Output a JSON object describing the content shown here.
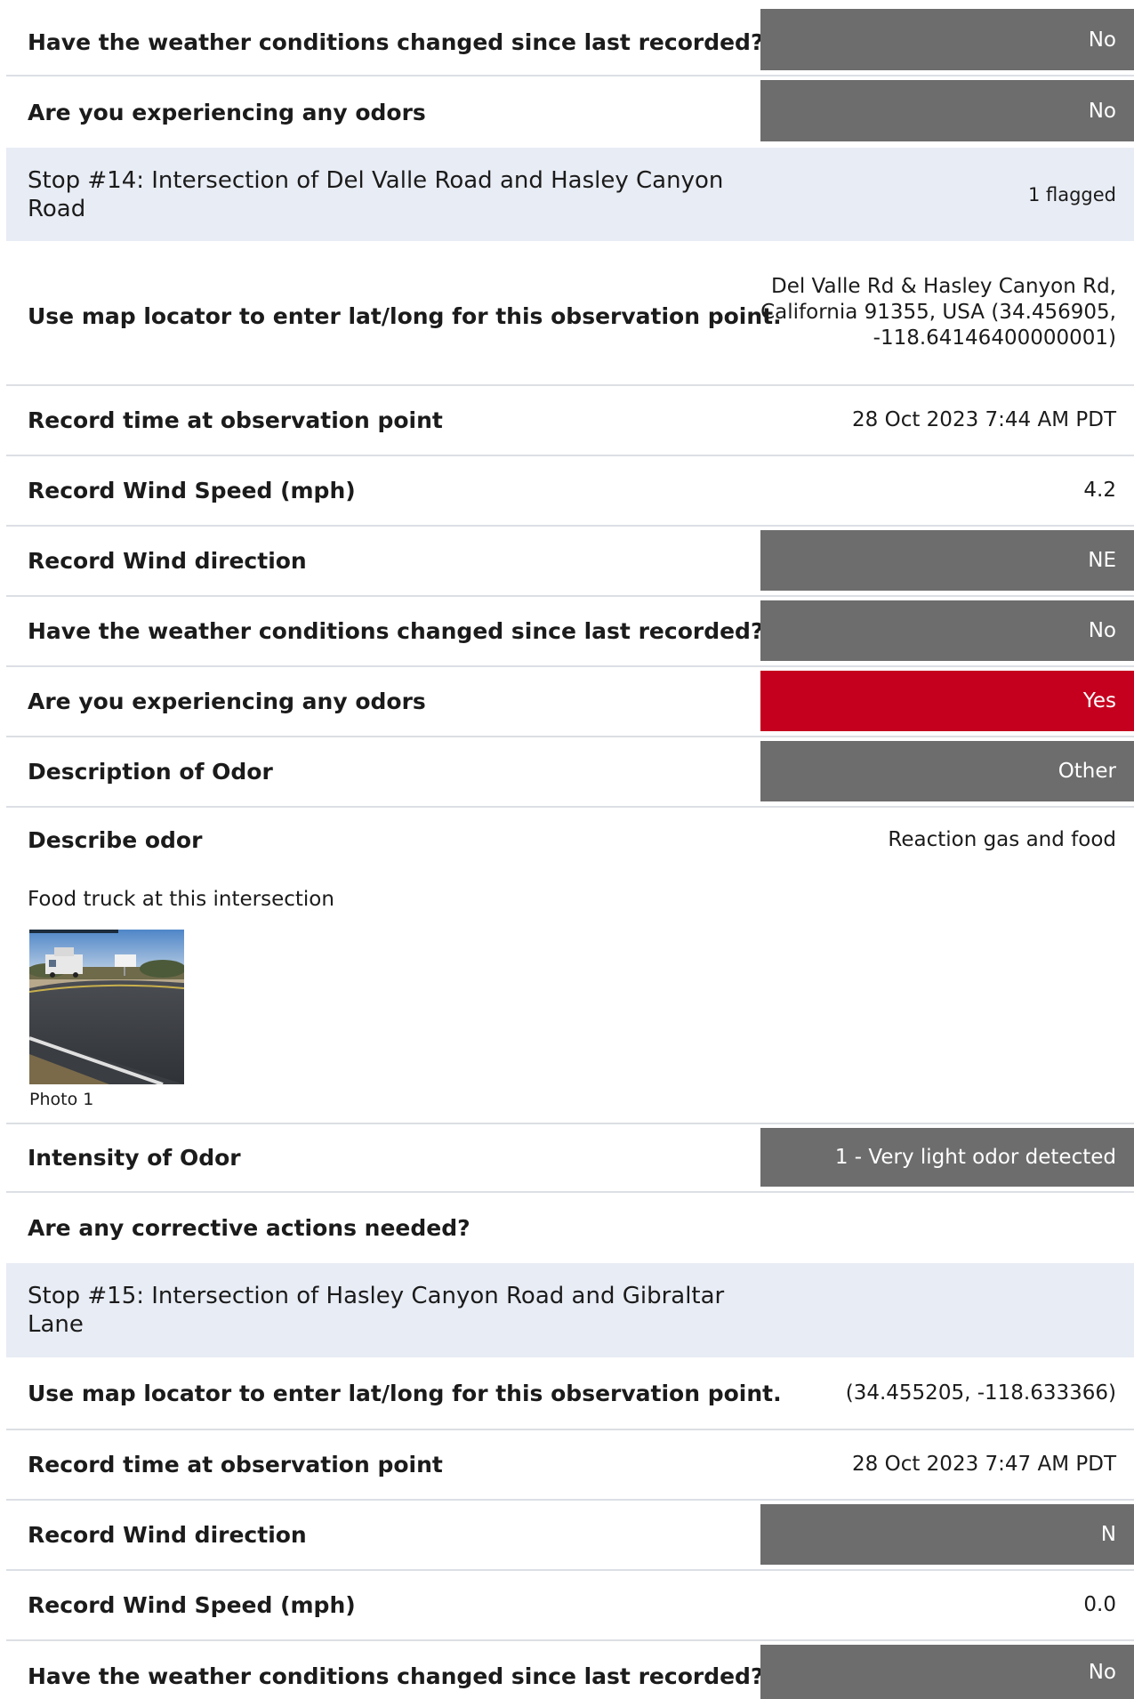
{
  "rows_a": [
    {
      "q": "Have the weather conditions changed since last recorded?",
      "v": "No",
      "style": "grey"
    },
    {
      "q": "Are you experiencing any odors",
      "v": "No",
      "style": "grey"
    }
  ],
  "stop14": {
    "title": "Stop #14: Intersection of Del Valle Road and Hasley Canyon Road",
    "flag": "1 flagged"
  },
  "stop14_rows": [
    {
      "q": "Use map locator to enter lat/long for this observation point.",
      "v": "Del Valle Rd & Hasley Canyon Rd, California 91355, USA (34.456905, -118.64146400000001)",
      "style": "plain"
    },
    {
      "q": "Record time at observation point",
      "v": "28 Oct 2023 7:44 AM PDT",
      "style": "plain"
    },
    {
      "q": "Record Wind Speed (mph)",
      "v": "4.2",
      "style": "plain"
    },
    {
      "q": "Record Wind direction",
      "v": "NE",
      "style": "grey"
    },
    {
      "q": "Have the weather conditions changed since last recorded?",
      "v": "No",
      "style": "grey"
    },
    {
      "q": "Are you experiencing any odors",
      "v": "Yes",
      "style": "red"
    },
    {
      "q": "Description of Odor",
      "v": "Other",
      "style": "grey"
    }
  ],
  "describe_odor": {
    "q": "Describe odor",
    "v": "Reaction gas and food",
    "note": "Food truck at this intersection",
    "photo_caption": "Photo 1"
  },
  "stop14_rows_b": [
    {
      "q": "Intensity of Odor",
      "v": "1 - Very light odor detected",
      "style": "grey"
    },
    {
      "q": "Are any corrective actions needed?",
      "v": "",
      "style": "plain"
    }
  ],
  "stop15": {
    "title": "Stop #15: Intersection of Hasley Canyon Road and Gibraltar Lane",
    "flag": ""
  },
  "stop15_rows": [
    {
      "q": "Use map locator to enter lat/long for this observation point.",
      "v": "(34.455205, -118.633366)",
      "style": "plain"
    },
    {
      "q": "Record time at observation point",
      "v": "28 Oct 2023 7:47 AM PDT",
      "style": "plain"
    },
    {
      "q": "Record Wind direction",
      "v": "N",
      "style": "grey"
    },
    {
      "q": "Record Wind Speed (mph)",
      "v": "0.0",
      "style": "plain"
    },
    {
      "q": "Have the weather conditions changed since last recorded?",
      "v": "No",
      "style": "grey"
    }
  ]
}
